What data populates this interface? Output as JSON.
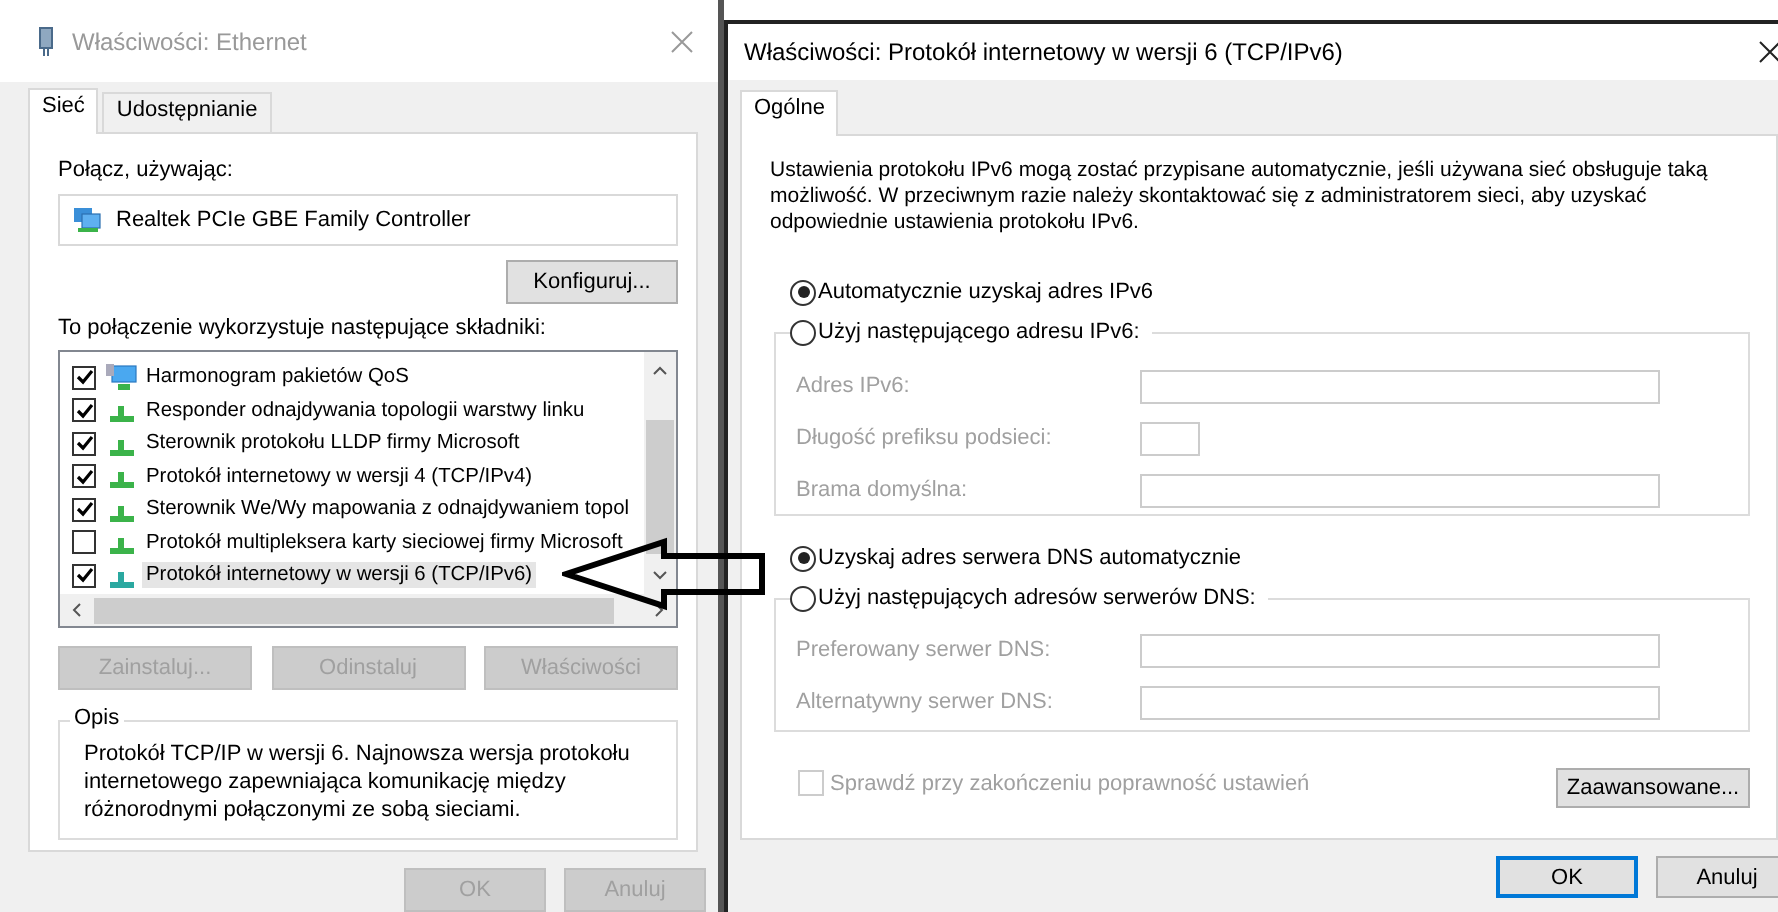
{
  "left_dialog": {
    "title": "Właściwości: Ethernet",
    "tabs": [
      {
        "label": "Sieć",
        "selected": true
      },
      {
        "label": "Udostępnianie",
        "selected": false
      }
    ],
    "connect_label": "Połącz, używając:",
    "adapter": "Realtek PCIe GBE Family Controller",
    "configure_button": "Konfiguruj...",
    "components_label": "To połączenie wykorzystuje następujące składniki:",
    "components": [
      {
        "kind": "scheduler",
        "label": "Harmonogram pakietów QoS",
        "checked": true,
        "selected": false
      },
      {
        "kind": "protocol",
        "label": "Responder odnajdywania topologii warstwy linku",
        "checked": true,
        "selected": false
      },
      {
        "kind": "protocol",
        "label": "Sterownik protokołu LLDP firmy Microsoft",
        "checked": true,
        "selected": false
      },
      {
        "kind": "protocol",
        "label": "Protokół internetowy w wersji 4 (TCP/IPv4)",
        "checked": true,
        "selected": false
      },
      {
        "kind": "protocol",
        "label": "Sterownik We/Wy mapowania z odnajdywaniem topol",
        "checked": true,
        "selected": false
      },
      {
        "kind": "protocol",
        "label": "Protokół multipleksera karty sieciowej firmy Microsoft",
        "checked": false,
        "selected": false
      },
      {
        "kind": "protocol",
        "label": "Protokół internetowy w wersji 6 (TCP/IPv6)",
        "checked": true,
        "selected": true
      }
    ],
    "buttons": [
      {
        "label": "Zainstaluj...",
        "disabled": true
      },
      {
        "label": "Odinstaluj",
        "disabled": true
      },
      {
        "label": "Właściwości",
        "disabled": true
      }
    ],
    "description": {
      "title": "Opis",
      "text": "Protokół TCP/IP w wersji 6. Najnowsza wersja protokołu internetowego zapewniająca komunikację między różnorodnymi połączonymi ze sobą sieciami."
    },
    "footer_buttons": [
      {
        "label": "OK",
        "disabled": true
      },
      {
        "label": "Anuluj",
        "disabled": true
      }
    ]
  },
  "right_dialog": {
    "title": "Właściwości: Protokół internetowy w wersji 6 (TCP/IPv6)",
    "tabs": [
      {
        "label": "Ogólne",
        "selected": true
      }
    ],
    "intro": "Ustawienia protokołu IPv6 mogą zostać przypisane automatycznie, jeśli używana sieć obsługuje taką możliwość. W przeciwnym razie należy skontaktować się z administratorem sieci, aby uzyskać odpowiednie ustawienia protokołu IPv6.",
    "auto_address": {
      "label": "Automatycznie uzyskaj adres IPv6",
      "selected": true
    },
    "manual_address": {
      "label": "Użyj następującego adresu IPv6:",
      "selected": false
    },
    "address_fields": [
      {
        "kind": "wide",
        "label": "Adres IPv6:",
        "disabled": true
      },
      {
        "kind": "short",
        "label": "Długość prefiksu podsieci:",
        "disabled": true
      },
      {
        "kind": "wide",
        "label": "Brama domyślna:",
        "disabled": true
      }
    ],
    "auto_dns": {
      "label": "Uzyskaj adres serwera DNS automatycznie",
      "selected": true
    },
    "manual_dns": {
      "label": "Użyj następujących adresów serwerów DNS:",
      "selected": false
    },
    "dns_fields": [
      {
        "label": "Preferowany serwer DNS:",
        "disabled": true
      },
      {
        "label": "Alternatywny serwer DNS:",
        "disabled": true
      }
    ],
    "validate": {
      "label": "Sprawdź przy zakończeniu poprawność ustawień",
      "checked": false,
      "disabled": true
    },
    "advanced_button": "Zaawansowane...",
    "footer_buttons": [
      {
        "label": "OK",
        "default": true
      },
      {
        "label": "Anuluj",
        "default": false
      }
    ]
  }
}
